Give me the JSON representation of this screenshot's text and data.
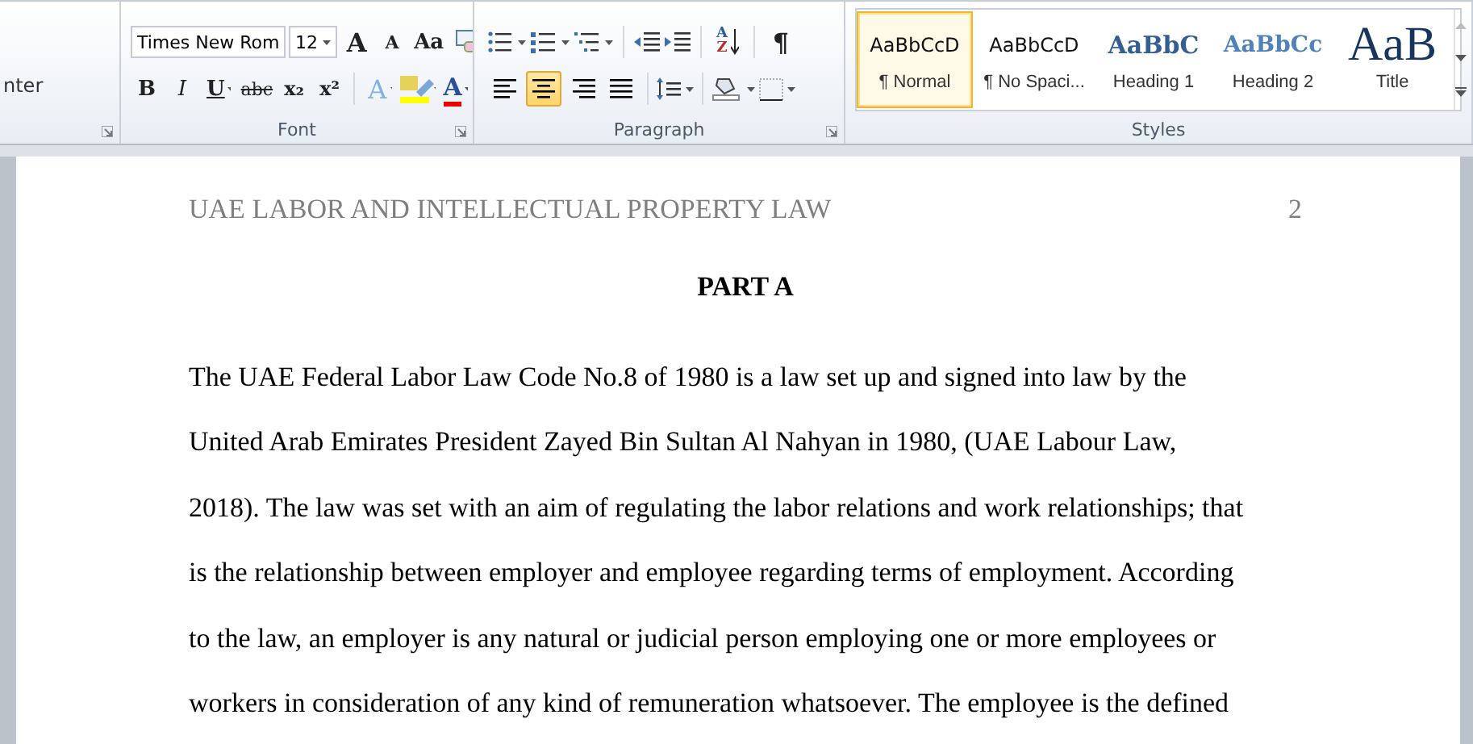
{
  "ribbon": {
    "clipped_control": "nter",
    "font_group": {
      "label": "Font",
      "font_name": "Times New Rom",
      "font_size": "12",
      "grow_font": "A",
      "shrink_font": "A",
      "change_case": "Aa",
      "bold": "B",
      "italic": "I",
      "underline": "U",
      "strikethrough": "abc",
      "subscript": "x₂",
      "superscript": "x²",
      "text_effects": "A",
      "font_color": "A"
    },
    "paragraph_group": {
      "label": "Paragraph",
      "sort_letters": [
        "A",
        "Z"
      ],
      "pilcrow": "¶",
      "alignments": [
        {
          "kind": "left",
          "selected": false
        },
        {
          "kind": "center",
          "selected": true
        },
        {
          "kind": "right",
          "selected": false
        },
        {
          "kind": "justify",
          "selected": false
        }
      ]
    },
    "styles_group": {
      "label": "Styles",
      "styles": [
        {
          "kind": "normal",
          "preview": "AaBbCcD",
          "name": "¶ Normal",
          "selected": true
        },
        {
          "kind": "normal",
          "preview": "AaBbCcD",
          "name": "¶ No Spaci...",
          "selected": false
        },
        {
          "kind": "heading1",
          "preview": "AaBbC",
          "name": "Heading 1",
          "selected": false
        },
        {
          "kind": "heading2",
          "preview": "AaBbCc",
          "name": "Heading 2",
          "selected": false
        },
        {
          "kind": "title",
          "preview": "AaB",
          "name": "Title",
          "selected": false
        }
      ]
    }
  },
  "document": {
    "header": "UAE LABOR AND INTELLECTUAL PROPERTY LAW",
    "page_number": "2",
    "heading": "PART A",
    "paragraph_lines": [
      "The UAE Federal Labor Law Code No.8 of 1980 is a law set up and signed into law by the",
      "United Arab Emirates President Zayed Bin Sultan Al Nahyan in 1980, (UAE Labour Law,",
      "2018). The law was set with an aim of regulating the labor relations and work relationships; that",
      "is the relationship between employer and employee regarding terms of employment. According",
      "to the law, an employer is any natural or judicial person employing one or more employees or",
      "workers in consideration of any kind of remuneration whatsoever. The employee is the defined"
    ]
  }
}
